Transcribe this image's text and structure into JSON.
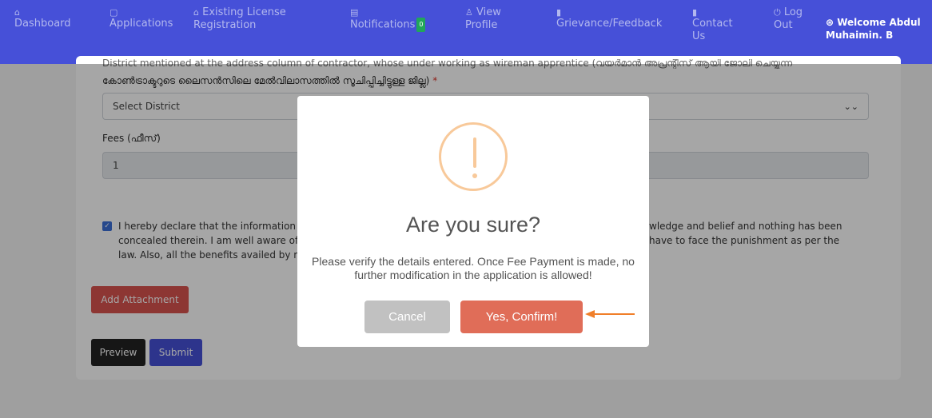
{
  "navbar": {
    "items": [
      {
        "icon": "home-icon",
        "glyph": "⌂",
        "label": "Dashboard"
      },
      {
        "icon": "applications-icon",
        "glyph": "▢",
        "label": "Applications"
      },
      {
        "icon": "license-icon",
        "glyph": "⌂",
        "label": "Existing License Registration"
      },
      {
        "icon": "notifications-icon",
        "glyph": "▤",
        "label": "Notifications",
        "badge": "0"
      },
      {
        "icon": "profile-icon",
        "glyph": "♙",
        "label": "View Profile"
      },
      {
        "icon": "grievance-icon",
        "glyph": "▮",
        "label": "Grievance/Feedback"
      },
      {
        "icon": "contact-icon",
        "glyph": "▮",
        "label": "Contact Us"
      },
      {
        "icon": "logout-icon",
        "glyph": "⏻",
        "label": "Log Out"
      }
    ],
    "welcome": "Welcome Abdul Muhaimin. B"
  },
  "form": {
    "district_label_partial": "District mentioned at the address column of contractor, whose under working as wireman apprentice (വയർമാൻ അപ്രന്റീസ് ആയി ജോലി ചെയ്യുന്ന",
    "district_label": "കോൺട്രാക്ടറുടെ ലൈസൻസിലെ മേൽവിലാസത്തിൽ സൂചിപ്പിച്ചിട്ടുള്ള ജില്ല)",
    "required_mark": "*",
    "district_select": "Select District",
    "fees_label": "Fees (ഫീസ്)",
    "fees_value": "1",
    "declaration_left_1": "I hereby declare that the information g",
    "declaration_right_1": "wledge and belief and nothing has been",
    "declaration_left_2": "concealed therein. I am well aware of",
    "declaration_right_2": "have to face the punishment as per the",
    "declaration_left_3": "law. Also, all the benefits availed by m",
    "add_attachment": "Add Attachment",
    "preview": "Preview",
    "submit": "Submit"
  },
  "modal": {
    "title": "Are you sure?",
    "text": "Please verify the details entered. Once Fee Payment is made, no further modification in the application is allowed!",
    "cancel": "Cancel",
    "confirm": "Yes, Confirm!"
  },
  "colors": {
    "navbar": "#4650d8",
    "confirm": "#e06d58",
    "cancel": "#c1c1c1",
    "warning": "#f8c99a",
    "arrow": "#f07f2a"
  }
}
